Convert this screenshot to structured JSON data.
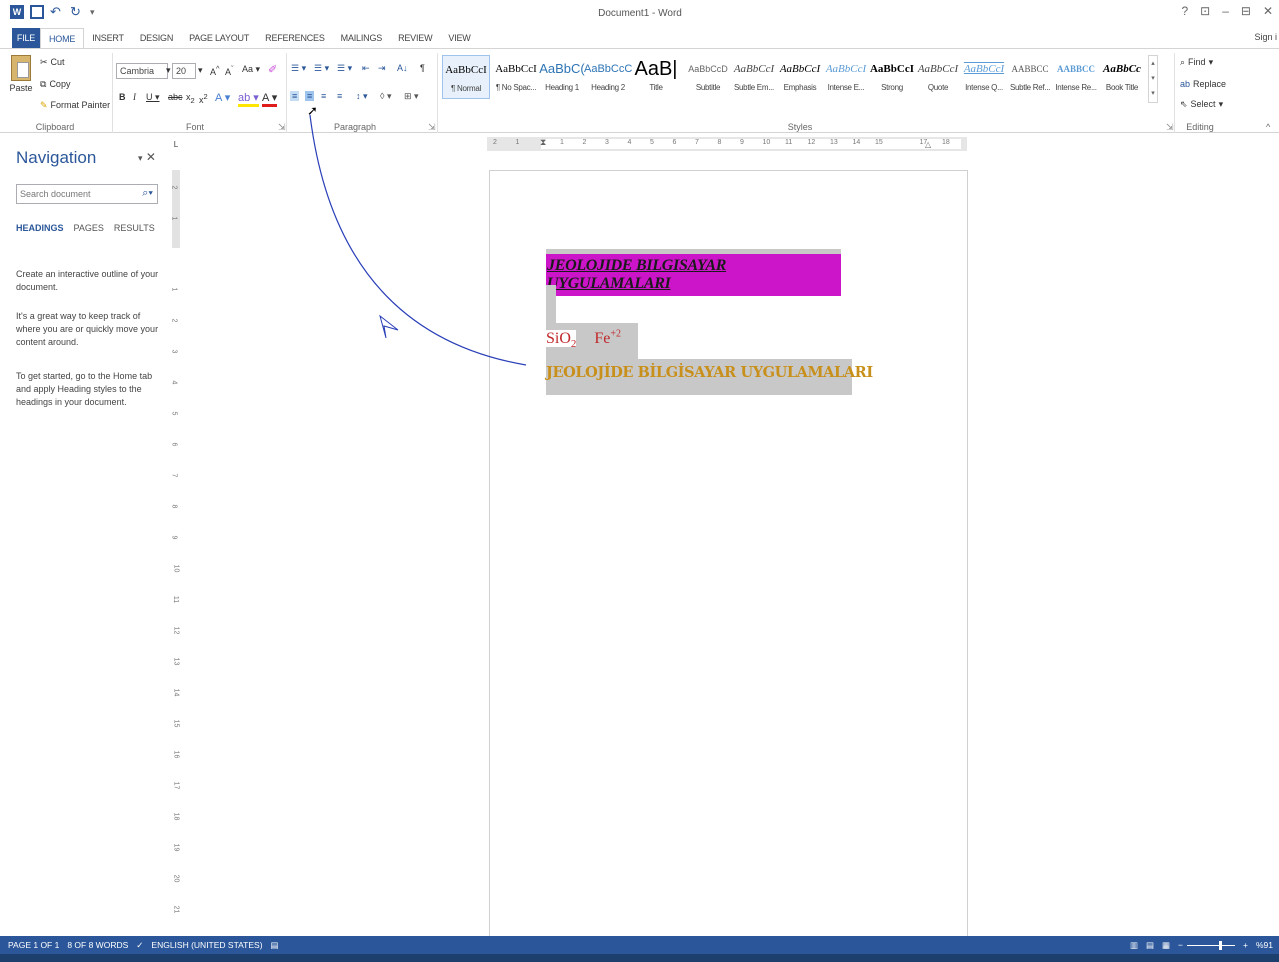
{
  "window": {
    "title": "Document1 - Word",
    "controls": [
      "?",
      "⊡",
      "–",
      "⊟",
      "✕"
    ],
    "sign_in": "Sign i"
  },
  "tabs": [
    "FILE",
    "HOME",
    "INSERT",
    "DESIGN",
    "PAGE LAYOUT",
    "REFERENCES",
    "MAILINGS",
    "REVIEW",
    "VIEW"
  ],
  "active_tab": "HOME",
  "clipboard": {
    "paste": "Paste",
    "cut": "Cut",
    "copy": "Copy",
    "format_painter": "Format Painter",
    "label": "Clipboard"
  },
  "font": {
    "name": "Cambria",
    "size": "20",
    "label": "Font"
  },
  "paragraph": {
    "label": "Paragraph"
  },
  "styles": {
    "label": "Styles",
    "items": [
      {
        "preview": "AaBbCcI",
        "name": "¶ Normal"
      },
      {
        "preview": "AaBbCcI",
        "name": "¶ No Spac..."
      },
      {
        "preview": "AaBbC(",
        "name": "Heading 1"
      },
      {
        "preview": "AaBbCcC",
        "name": "Heading 2"
      },
      {
        "preview": "AaB|",
        "name": "Title"
      },
      {
        "preview": "AaBbCcD",
        "name": "Subtitle"
      },
      {
        "preview": "AaBbCcI",
        "name": "Subtle Em..."
      },
      {
        "preview": "AaBbCcI",
        "name": "Emphasis"
      },
      {
        "preview": "AaBbCcI",
        "name": "Intense E..."
      },
      {
        "preview": "AaBbCcI",
        "name": "Strong"
      },
      {
        "preview": "AaBbCcI",
        "name": "Quote"
      },
      {
        "preview": "AaBbCcI",
        "name": "Intense Q..."
      },
      {
        "preview": "AABBCC",
        "name": "Subtle Ref..."
      },
      {
        "preview": "AABBCC",
        "name": "Intense Re..."
      },
      {
        "preview": "AaBbCc",
        "name": "Book Title"
      }
    ]
  },
  "editing": {
    "find": "Find",
    "replace": "Replace",
    "select": "Select",
    "label": "Editing"
  },
  "navigation": {
    "title": "Navigation",
    "search_placeholder": "Search document",
    "tabs": [
      "HEADINGS",
      "PAGES",
      "RESULTS"
    ],
    "p1": "Create an interactive outline of your document.",
    "p2": "It's a great way to keep track of where you are or quickly move your content around.",
    "p3": "To get started, go to the Home tab and apply Heading styles to the headings in your document."
  },
  "ruler": {
    "h_ticks": [
      "2",
      "1",
      "1",
      "2",
      "3",
      "4",
      "5",
      "6",
      "7",
      "8",
      "9",
      "10",
      "11",
      "12",
      "13",
      "14",
      "15",
      "17",
      "18"
    ],
    "v_ticks": [
      "2",
      "1",
      "1",
      "2",
      "3",
      "4",
      "5",
      "6",
      "7",
      "8",
      "9",
      "10",
      "11",
      "12",
      "13",
      "14",
      "15",
      "16",
      "17",
      "18",
      "19",
      "20",
      "21"
    ]
  },
  "document": {
    "line1": "JEOLOJIDE BILGISAYAR UYGULAMALARI",
    "sio2_main": "SiO",
    "sio2_sub": "2",
    "fe_main": "Fe",
    "fe_sup": "+2",
    "line3": "JEOLOJİDE BİLGİSAYAR UYGULAMALARI"
  },
  "status": {
    "page": "PAGE 1 OF 1",
    "words": "8 OF 8 WORDS",
    "language": "ENGLISH (UNITED STATES)",
    "zoom": "%91"
  },
  "colors": {
    "accent": "#2b579a",
    "highlight_magenta": "#cc14c8",
    "gray_highlight": "#c8c8c8",
    "dark_red_text": "#c0282b",
    "gold_text": "#c8901a"
  }
}
